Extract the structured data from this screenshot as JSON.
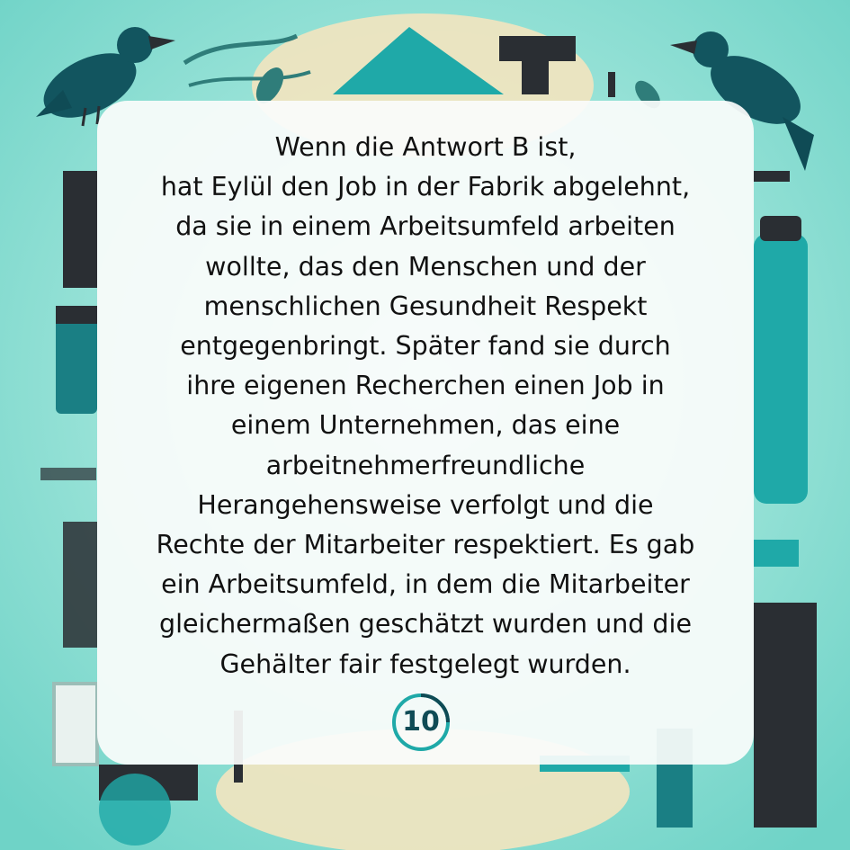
{
  "story": {
    "lines": [
      "Wenn die Antwort B ist,",
      "hat Eylül den Job in der Fabrik abgelehnt,",
      "da sie in einem Arbeitsumfeld arbeiten",
      "wollte, das den Menschen und der",
      "menschlichen Gesundheit Respekt",
      "entgegenbringt. Später fand sie durch",
      "ihre eigenen Recherchen einen Job in",
      "einem Unternehmen, das eine",
      "arbeitnehmerfreundliche",
      "Herangehensweise verfolgt und die",
      "Rechte der Mitarbeiter respektiert. Es gab",
      "ein Arbeitsumfeld, in dem die Mitarbeiter",
      "gleichermaßen geschätzt wurden und die",
      "Gehälter fair festgelegt wurden."
    ]
  },
  "page_number": "10",
  "colors": {
    "background": "#8fe3d6",
    "teal": "#1fa9a8",
    "dark_teal": "#0f4b55",
    "charcoal": "#2a2e33",
    "cream": "#f3e4bf",
    "card": "#fafcfb"
  },
  "decorations": {
    "icons": [
      "crow-icon",
      "crow-icon",
      "feather-icon",
      "bottle-icon",
      "tool-icon"
    ]
  }
}
